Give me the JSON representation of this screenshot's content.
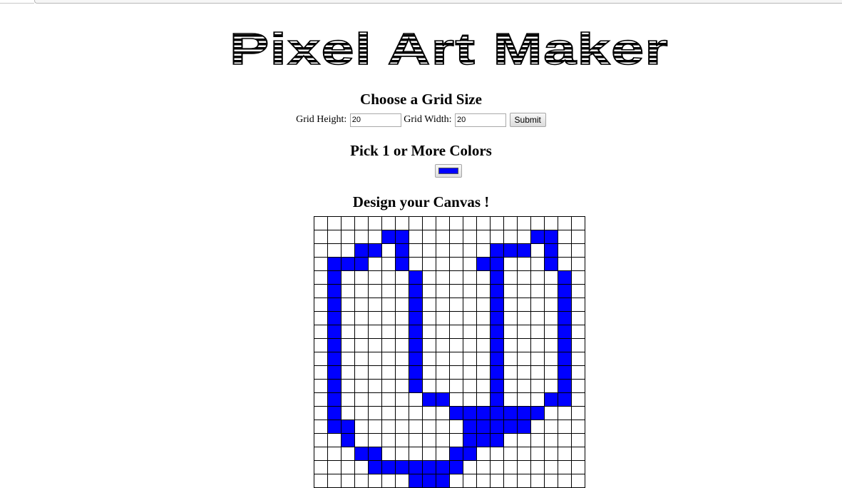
{
  "app": {
    "title": "Pixel Art Maker"
  },
  "grid_size": {
    "heading": "Choose a Grid Size",
    "height_label": "Grid Height:",
    "height_value": "20",
    "width_label": "Grid Width:",
    "width_value": "20",
    "submit_label": "Submit"
  },
  "colors": {
    "heading": "Pick 1 or More Colors",
    "selected_color": "#0000ff"
  },
  "canvas": {
    "heading": "Design your Canvas !",
    "rows": 20,
    "cols": 20,
    "fill_color": "#0000ff",
    "empty_color": "#ffffff",
    "pixels": [
      "00000000000000000000",
      "00000110000000001100",
      "00011010000001110100",
      "01110010000011000100",
      "01000001000001000010",
      "01000001000001000010",
      "01000001000001000010",
      "01000001000001000010",
      "01000001000001000010",
      "01000001000001000010",
      "01000001000001000010",
      "01000001000001000010",
      "01000001000001000010",
      "01000000110001000110",
      "01000000001111111000",
      "01100000000111110000",
      "00100000000111000000",
      "00011000001100000000",
      "00001111111000000000",
      "00000001110000000000"
    ]
  }
}
